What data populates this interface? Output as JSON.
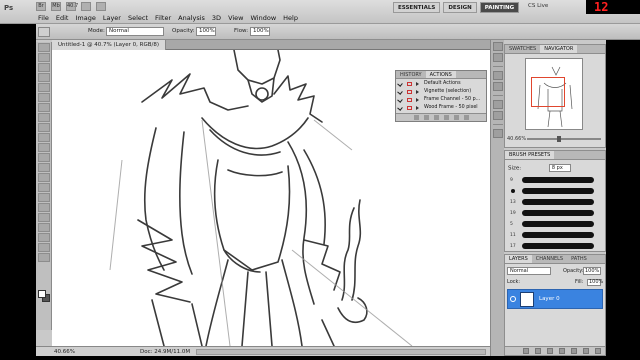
{
  "app": {
    "logo": "Ps"
  },
  "menu": [
    "File",
    "Edit",
    "Image",
    "Layer",
    "Select",
    "Filter",
    "Analysis",
    "3D",
    "View",
    "Window",
    "Help"
  ],
  "zoom_top": "40.7",
  "workspaces": [
    {
      "label": "ESSENTIALS",
      "active": false
    },
    {
      "label": "DESIGN",
      "active": false
    },
    {
      "label": "PAINTING",
      "active": true
    }
  ],
  "cs_live": "CS Live",
  "clock": "12",
  "options": {
    "mode_label": "Mode:",
    "mode_value": "Normal",
    "opacity_label": "Opacity:",
    "opacity_value": "100%",
    "flow_label": "Flow:",
    "flow_value": "100%"
  },
  "document": {
    "tab": "Untitled-1 @ 40.7% (Layer 0, RGB/8)"
  },
  "status": {
    "zoom": "40.66%",
    "doc": "Doc: 24.9M/11.0M"
  },
  "navigator": {
    "tabs": [
      "SWATCHES",
      "NAVIGATOR"
    ],
    "zoom": "40.66%"
  },
  "brush_presets": {
    "tab": "BRUSH PRESETS",
    "size_label": "Size:",
    "size_value": "8 px",
    "sizes": [
      "9",
      "13",
      "19",
      "5",
      "11",
      "17",
      "21",
      "10"
    ]
  },
  "layers": {
    "tabs": [
      "LAYERS",
      "CHANNELS",
      "PATHS"
    ],
    "blend": "Normal",
    "opacity_label": "Opacity:",
    "opacity": "100%",
    "lock_label": "Lock:",
    "fill_label": "Fill:",
    "fill": "100%",
    "items": [
      {
        "name": "Layer 0"
      }
    ]
  },
  "actions": {
    "tabs": [
      "HISTORY",
      "ACTIONS"
    ],
    "items": [
      {
        "label": "Default Actions"
      },
      {
        "label": "Vignette (selection)"
      },
      {
        "label": "Frame Channel - 50 p..."
      },
      {
        "label": "Wood Frame - 50 pixel"
      }
    ]
  },
  "colors": {
    "accent": "#3a83e0",
    "workspace_active": "#4a4a4a",
    "clock": "#ff2020"
  }
}
